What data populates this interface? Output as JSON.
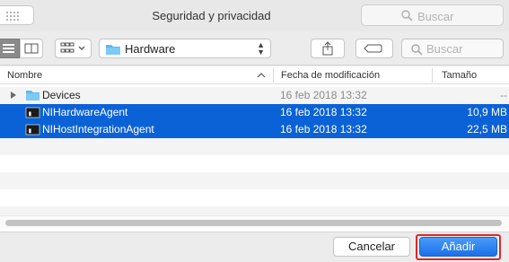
{
  "window": {
    "title": "Seguridad y privacidad",
    "search_placeholder": "Buscar"
  },
  "toolbar": {
    "view_list_icon": "list-view-icon",
    "view_columns_icon": "column-view-icon",
    "group_icon": "group-by-icon",
    "location": "Hardware",
    "share_icon": "share-icon",
    "tag_icon": "tag-icon",
    "search_placeholder": "Buscar"
  },
  "columns": {
    "name": "Nombre",
    "date": "Fecha de modificación",
    "size": "Tamaño"
  },
  "files": [
    {
      "name": "Devices",
      "date": "16 feb 2018 13:32",
      "size": "--",
      "kind": "folder",
      "selected": false
    },
    {
      "name": "NIHardwareAgent",
      "date": "16 feb 2018 13:32",
      "size": "10,9 MB",
      "kind": "executable",
      "selected": true
    },
    {
      "name": "NIHostIntegrationAgent",
      "date": "16 feb 2018 13:32",
      "size": "22,5 MB",
      "kind": "executable",
      "selected": true
    }
  ],
  "footer": {
    "cancel_label": "Cancelar",
    "add_label": "Añadir"
  },
  "colors": {
    "selection": "#0b62d6",
    "primary_button": "#1a6fe9",
    "highlight_frame": "#e0262a"
  }
}
